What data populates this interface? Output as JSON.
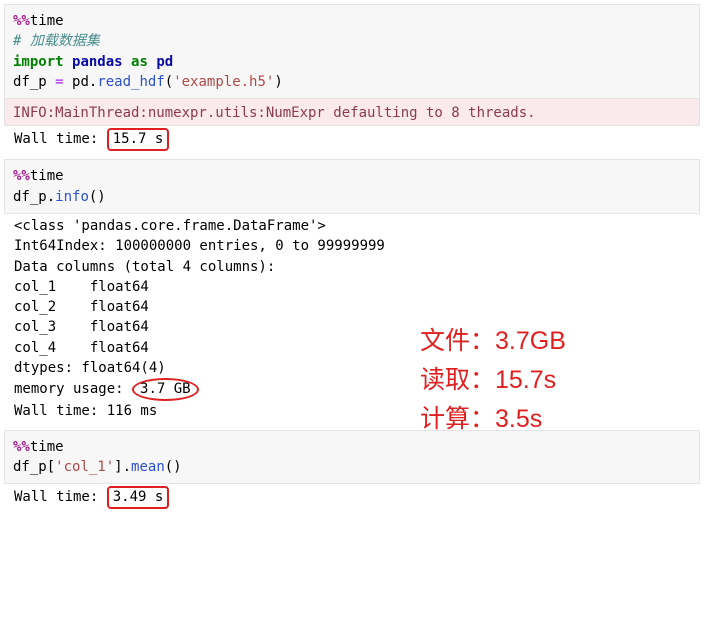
{
  "cell1": {
    "magic": "%%",
    "magic2": "time",
    "comment": "# 加载数据集",
    "kw_import": "import",
    "mod_pandas": "pandas",
    "kw_as": "as",
    "mod_pd": "pd",
    "var": "df_p ",
    "op_eq": "=",
    "assign_rhs1": " pd.",
    "call_read": "read_hdf",
    "paren_o": "(",
    "str_file": "'example.h5'",
    "paren_c": ")"
  },
  "out1": {
    "info_line": "INFO:MainThread:numexpr.utils:NumExpr defaulting to 8 threads.",
    "wall_pre": "Wall time: ",
    "wall_val": "15.7 s"
  },
  "cell2": {
    "magic": "%%",
    "magic2": "time",
    "obj": "df_p.",
    "call": "info",
    "paren": "()"
  },
  "out2": {
    "l1": "<class 'pandas.core.frame.DataFrame'>",
    "l2": "Int64Index: 100000000 entries, 0 to 99999999",
    "l3": "Data columns (total 4 columns):",
    "l4": "col_1    float64",
    "l5": "col_2    float64",
    "l6": "col_3    float64",
    "l7": "col_4    float64",
    "l8a": "dtypes: float64(4",
    "l8b": ")",
    "l9a": "memory usage: ",
    "mem_val": "3.7 GB",
    "l10": "Wall time: 116 ms"
  },
  "cell3": {
    "magic": "%%",
    "magic2": "time",
    "obj": "df_p[",
    "str_col": "'col_1'",
    "rest1": "].",
    "call": "mean",
    "paren": "()"
  },
  "out3": {
    "wall_pre": "Wall time: ",
    "wall_val": "3.49 s"
  },
  "annot": {
    "l1": "文件：3.7GB",
    "l2": "读取：15.7s",
    "l3": "计算：3.5s"
  }
}
